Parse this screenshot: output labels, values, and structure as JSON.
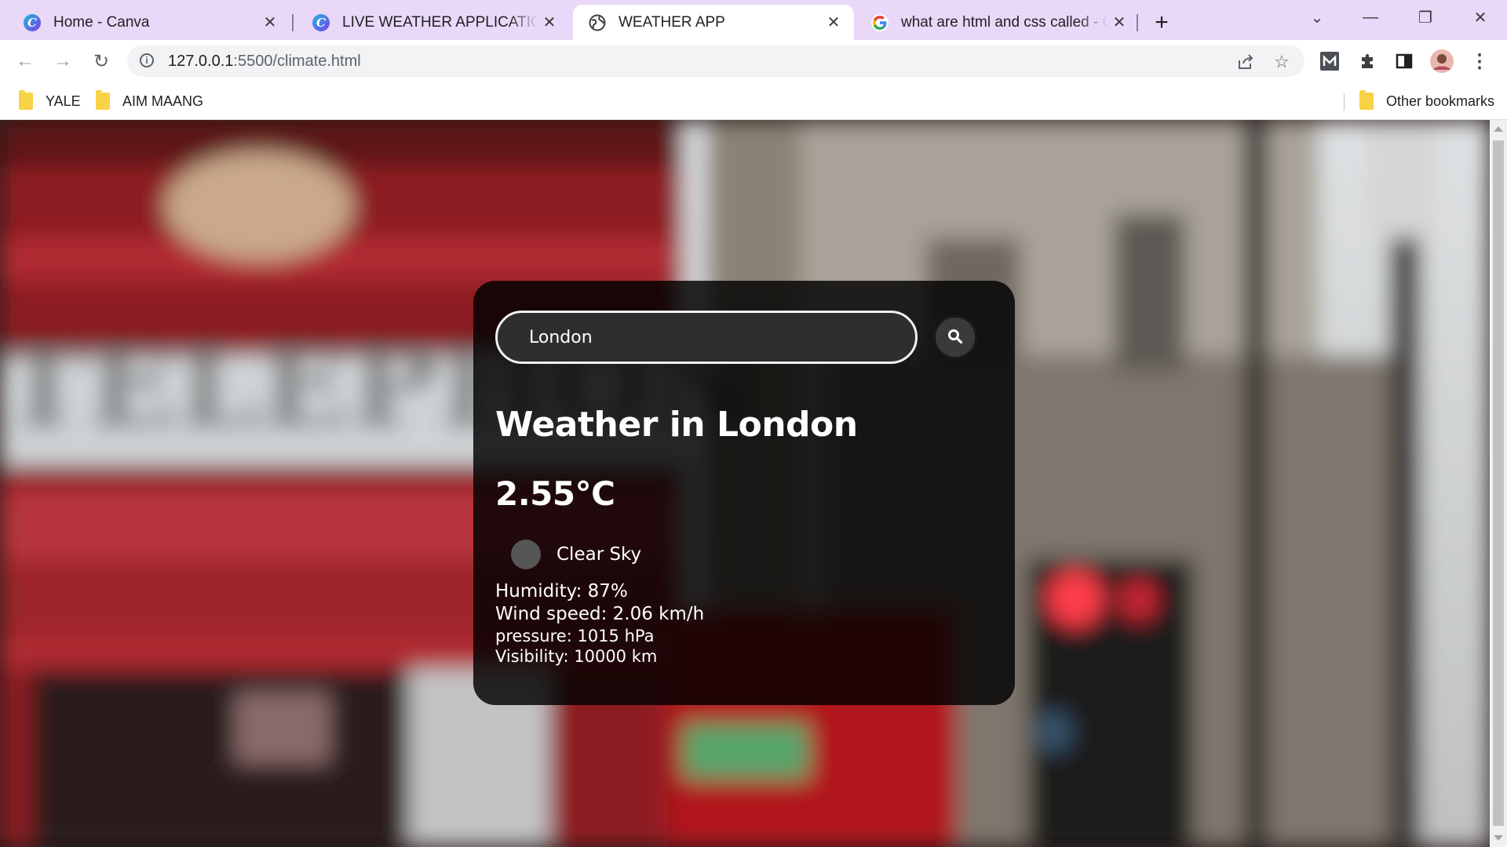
{
  "browser": {
    "tabs": [
      {
        "title": "Home - Canva",
        "favicon": "canva-icon",
        "active": false
      },
      {
        "title": "LIVE WEATHER APPLICATION - Pr",
        "favicon": "canva-icon",
        "active": false
      },
      {
        "title": "WEATHER APP",
        "favicon": "globe-icon",
        "active": true
      },
      {
        "title": "what are html and css called - Go",
        "favicon": "google-icon",
        "active": false
      }
    ],
    "url_host": "127.0.0.1",
    "url_rest": ":5500/climate.html",
    "bookmarks": [
      {
        "label": "YALE"
      },
      {
        "label": "AIM MAANG"
      }
    ],
    "other_bookmarks": "Other bookmarks",
    "accent_tabstrip": "#e9d8f7"
  },
  "weather": {
    "search": {
      "value": "London",
      "placeholder": ""
    },
    "city_title": "Weather in London",
    "temperature": "2.55°C",
    "description": "Clear Sky",
    "humidity": "Humidity: 87%",
    "wind": "Wind speed: 2.06 km/h",
    "pressure": "pressure: 1015 hPa",
    "visibility": "Visibility: 10000 km"
  }
}
